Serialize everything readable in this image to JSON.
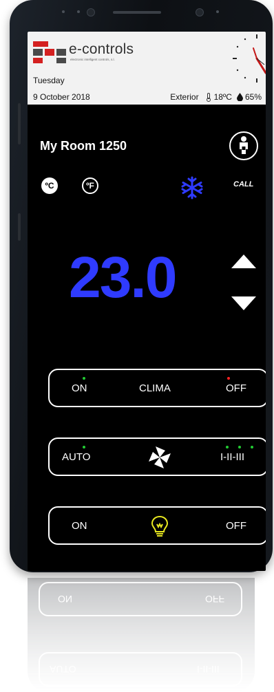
{
  "header": {
    "brand": "e-controls",
    "brand_sub": "electronic intelligent controls, s.l.",
    "day": "Tuesday",
    "date": "9 October 2018",
    "exterior_label": "Exterior",
    "exterior_temp": "18ºC",
    "exterior_humidity": "65%"
  },
  "room": {
    "name": "My Room 1250",
    "call_label": "CALL",
    "unit_c": "ºC",
    "unit_f": "ºF",
    "mode_icon": "snowflake-icon",
    "temperature": "23.0"
  },
  "controls": {
    "clima": {
      "on": "ON",
      "label": "CLIMA",
      "off": "OFF"
    },
    "fan": {
      "auto": "AUTO",
      "speeds": "I-II-III",
      "icon": "fan-icon"
    },
    "light": {
      "on": "ON",
      "off": "OFF",
      "icon": "lightbulb-icon"
    }
  },
  "reflection": {
    "on": "ON",
    "off": "OFF",
    "auto": "AUTO",
    "speeds": "I-II-III"
  },
  "colors": {
    "accent_blue": "#2f3bff",
    "led_green": "#22cc33",
    "led_red": "#ff2222",
    "bulb_yellow": "#e8e820",
    "brand_red": "#d42020"
  }
}
